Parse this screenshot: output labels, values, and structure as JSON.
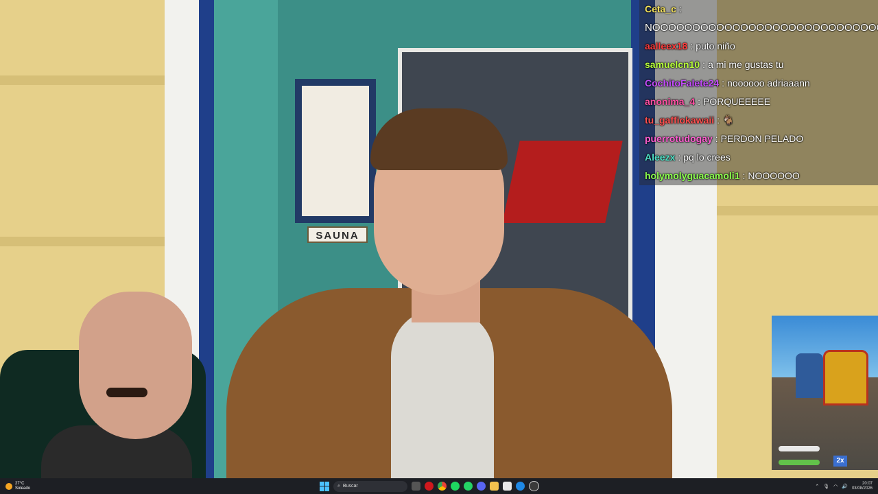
{
  "chat": [
    {
      "user": "Ceta_c",
      "message": "",
      "color": "#f2e05a"
    },
    {
      "user": "",
      "message": "NOOOOOOOOOOOOOOOOOOOOOOOOOOOOOO",
      "color": "#ffffff"
    },
    {
      "user": "aalleex18",
      "message": "puto niño",
      "color": "#ff3b3b"
    },
    {
      "user": "samuelcn10",
      "message": "a mi me gustas tu",
      "color": "#b7ff3a"
    },
    {
      "user": "CochitoFalete24",
      "message": "noooooo adriaaann",
      "color": "#c64cff"
    },
    {
      "user": "anonima_4",
      "message": "PORQUEEEEE",
      "color": "#ff4fa3"
    },
    {
      "user": "tu_gaffiokawaii",
      "message": "🐐",
      "color": "#ff4f4f"
    },
    {
      "user": "puerrotudogay",
      "message": "PERDON PELADO",
      "color": "#ff5fd2"
    },
    {
      "user": "Aleezx",
      "message": "pq lo crees",
      "color": "#4fe0c6"
    },
    {
      "user": "holymolyguacamoli1",
      "message": "NOOOOOO",
      "color": "#8cff4f"
    }
  ],
  "chat_separator": ":",
  "scene": {
    "sign_text": "SAUNA"
  },
  "game": {
    "multiplier": "2x"
  },
  "taskbar": {
    "weather_temp": "27°C",
    "weather_desc": "Soleado",
    "search_placeholder": "Buscar",
    "time": "20:07",
    "date": "03/08/2026",
    "pinned_apps": [
      "file-explorer-icon",
      "opera-icon",
      "chrome-icon",
      "spotify-icon",
      "whatsapp-icon",
      "discord-icon",
      "folder-icon",
      "capcut-icon",
      "edge-icon",
      "obs-icon"
    ]
  }
}
